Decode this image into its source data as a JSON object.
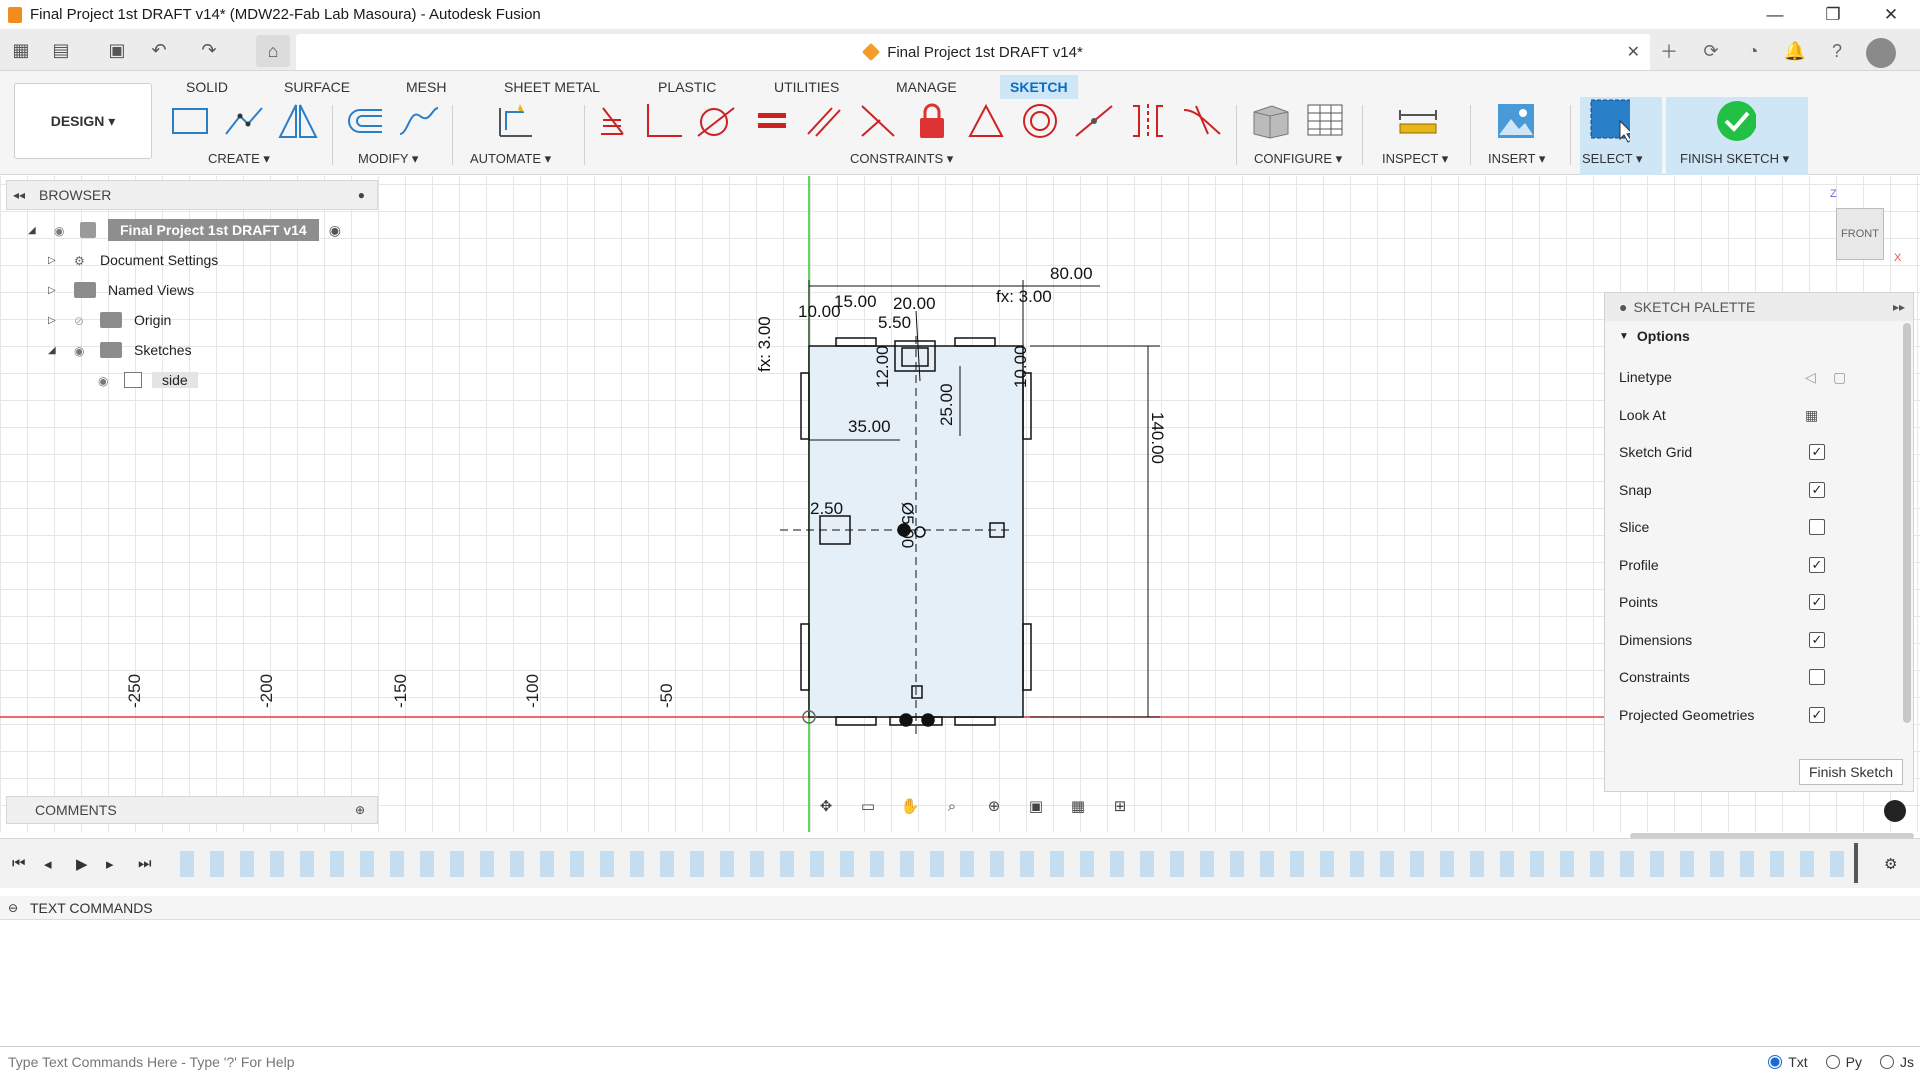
{
  "window": {
    "title": "Final Project 1st DRAFT v14* (MDW22-Fab Lab Masoura) - Autodesk Fusion",
    "minimize": "—",
    "restore": "❐",
    "close": "✕"
  },
  "doc_tab": {
    "title": "Final Project 1st DRAFT v14*",
    "close": "✕"
  },
  "ribbon": {
    "workspace": "DESIGN ▾",
    "tabs": [
      "SOLID",
      "SURFACE",
      "MESH",
      "SHEET METAL",
      "PLASTIC",
      "UTILITIES",
      "MANAGE",
      "SKETCH"
    ],
    "active_tab": "SKETCH",
    "groups": {
      "create": "CREATE ▾",
      "modify": "MODIFY ▾",
      "automate": "AUTOMATE ▾",
      "constraints": "CONSTRAINTS ▾",
      "configure": "CONFIGURE ▾",
      "inspect": "INSPECT ▾",
      "insert": "INSERT ▾",
      "select": "SELECT ▾",
      "finish_sketch": "FINISH SKETCH ▾"
    },
    "colors": {
      "active_tab_bg": "#cfe6f7",
      "active_tab_text": "#0a6dc2",
      "finish_green": "#22c044"
    }
  },
  "browser": {
    "title": "BROWSER",
    "root": "Final Project 1st DRAFT v14",
    "items": [
      {
        "label": "Document Settings"
      },
      {
        "label": "Named Views"
      },
      {
        "label": "Origin"
      },
      {
        "label": "Sketches"
      },
      {
        "label": "side"
      }
    ]
  },
  "comments": {
    "title": "COMMENTS"
  },
  "view_cube": {
    "face": "FRONT",
    "axis_z": "Z",
    "axis_x": "X"
  },
  "sketch": {
    "ruler_labels": [
      "-250",
      "-200",
      "-150",
      "-100",
      "-50"
    ],
    "dimensions": [
      "80.00",
      "15.00",
      "20.00",
      "10.00",
      "fx: 3.00",
      "fx: 3.00",
      "5.50",
      "12.00",
      "10.00",
      "25.00",
      "35.00",
      "140.00",
      "2.50",
      "Ø5.00"
    ]
  },
  "palette": {
    "title": "SKETCH PALETTE",
    "section": "Options",
    "rows": [
      {
        "label": "Linetype",
        "type": "icon"
      },
      {
        "label": "Look At",
        "type": "icon"
      },
      {
        "label": "Sketch Grid",
        "checked": true
      },
      {
        "label": "Snap",
        "checked": true
      },
      {
        "label": "Slice",
        "checked": false
      },
      {
        "label": "Profile",
        "checked": true
      },
      {
        "label": "Points",
        "checked": true
      },
      {
        "label": "Dimensions",
        "checked": true
      },
      {
        "label": "Constraints",
        "checked": false
      },
      {
        "label": "Projected Geometries",
        "checked": true
      }
    ],
    "finish_button": "Finish Sketch"
  },
  "text_commands": {
    "title": "TEXT COMMANDS",
    "placeholder": "Type Text Commands Here - Type '?' For Help",
    "modes": [
      "Txt",
      "Py",
      "Js"
    ],
    "selected_mode": "Txt"
  }
}
